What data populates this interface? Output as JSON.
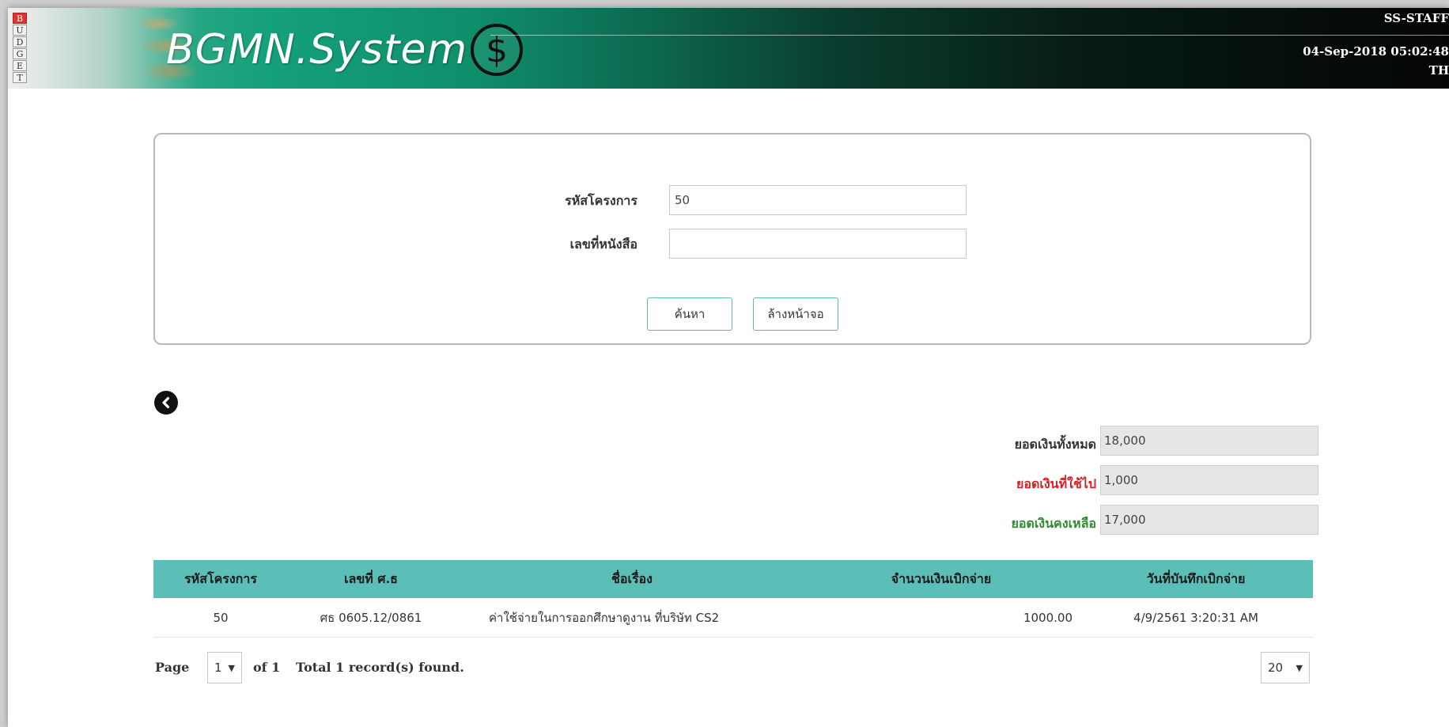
{
  "header": {
    "tag_letters": [
      "B",
      "U",
      "D",
      "G",
      "E",
      "T"
    ],
    "brand_text": "BGMN.System",
    "brand_symbol": "$",
    "user": "SS-STAFF",
    "datetime": "04-Sep-2018 05:02:48",
    "language": "TH"
  },
  "search": {
    "project_code_label": "รหัสโครงการ",
    "project_code_value": "50",
    "letter_no_label": "เลขที่หนังสือ",
    "letter_no_value": "",
    "search_button": "ค้นหา",
    "clear_button": "ล้างหน้าจอ"
  },
  "back": {
    "icon": "chevron-left-circle-icon"
  },
  "summary": {
    "total_label": "ยอดเงินทั้งหมด",
    "total_value": "18,000",
    "used_label": "ยอดเงินที่ใช้ไป",
    "used_value": "1,000",
    "remaining_label": "ยอดเงินคงเหลือ",
    "remaining_value": "17,000",
    "used_color": "#d81f26",
    "remaining_color": "#2e8b2e"
  },
  "table": {
    "headers": [
      "รหัสโครงการ",
      "เลขที่ ศ.ธ",
      "ชื่อเรื่อง",
      "จำนวนเงินเบิกจ่าย",
      "วันที่บันทึกเบิกจ่าย"
    ],
    "rows": [
      [
        "50",
        "ศธ 0605.12/0861",
        "ค่าใช้จ่ายในการออกศึกษาดูงาน ที่บริษัท CS2",
        "1000.00",
        "4/9/2561 3:20:31 AM"
      ]
    ],
    "header_color": "#5bbfb8"
  },
  "pager": {
    "page_label": "Page",
    "page_value": "1",
    "of_label": "of 1",
    "total_text": "Total 1 record(s) found.",
    "page_size": "20"
  }
}
